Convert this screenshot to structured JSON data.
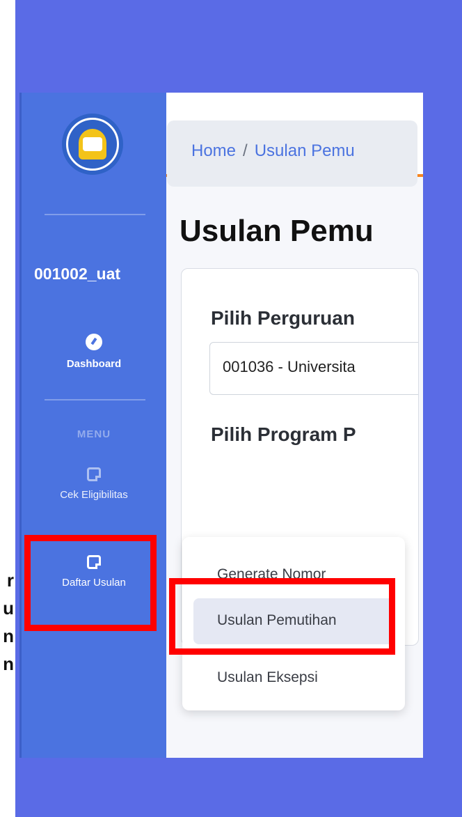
{
  "sidebar": {
    "username": "001002_uat",
    "dashboard_label": "Dashboard",
    "menu_heading": "MENU",
    "items": [
      {
        "label": "Cek Eligibilitas"
      },
      {
        "label": "Daftar Usulan"
      }
    ]
  },
  "topbar": {
    "menu_icon": "☰"
  },
  "breadcrumb": {
    "home": "Home",
    "separator": "/",
    "current": "Usulan Pemu"
  },
  "page": {
    "title": "Usulan Pemu",
    "field1_label": "Pilih Perguruan",
    "field1_value": "001036 - Universita",
    "field2_label": "Pilih Program P"
  },
  "dropdown": {
    "items": [
      {
        "label": "Generate Nomor"
      },
      {
        "label": "Usulan Pemutihan"
      },
      {
        "label": "Usulan Eksepsi"
      }
    ]
  },
  "edge_text": [
    "r",
    "u",
    "n",
    "n"
  ],
  "colors": {
    "sidebar": "#4b73e0",
    "accent": "#f7851f",
    "highlight": "#ff0000",
    "frame": "#5a6be6"
  }
}
